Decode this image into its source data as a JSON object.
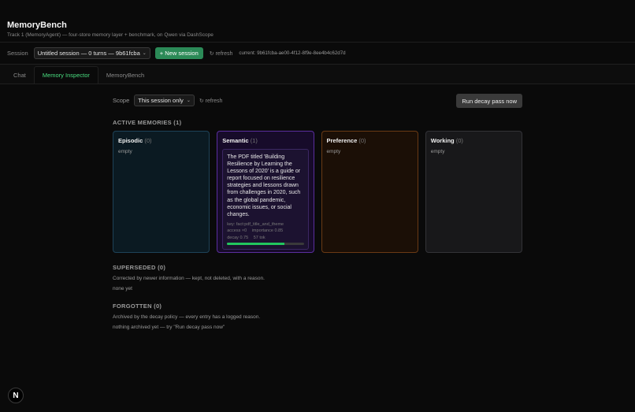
{
  "header": {
    "title": "MemoryBench",
    "subtitle": "Track 1 (MemoryAgent) — four-store memory layer + benchmark, on Qwen via DashScope"
  },
  "session_bar": {
    "label": "Session",
    "selected": "Untitled session — 0 turns — 9b61fcba",
    "new_session": "+ New session",
    "refresh": "↻ refresh",
    "current": "current: 9b61fcba-ae00-4f12-8f9e-8ee4b4c62d7d"
  },
  "tabs": [
    {
      "label": "Chat"
    },
    {
      "label": "Memory Inspector"
    },
    {
      "label": "MemoryBench"
    }
  ],
  "inspector": {
    "scope_label": "Scope",
    "scope_value": "This session only",
    "refresh": "↻ refresh",
    "decay_button": "Run decay pass now",
    "active_title": "ACTIVE MEMORIES (1)",
    "stores": [
      {
        "name": "Episodic",
        "count": "(0)",
        "empty": "empty"
      },
      {
        "name": "Semantic",
        "count": "(1)"
      },
      {
        "name": "Preference",
        "count": "(0)",
        "empty": "empty"
      },
      {
        "name": "Working",
        "count": "(0)",
        "empty": "empty"
      }
    ],
    "semantic_memory": {
      "text": "The PDF titled 'Building Resilience by Learning the Lessons of 2020' is a guide or report focused on resilience strategies and lessons drawn from challenges in 2020, such as the global pandemic, economic issues, or social changes.",
      "key": "key: fact:pdf_title_and_theme",
      "access": "access ×0",
      "importance": "importance 0.85",
      "decay": "decay 0.75",
      "tokens": "57 tok",
      "decay_value": 0.75
    },
    "superseded": {
      "title": "SUPERSEDED (0)",
      "desc": "Corrected by newer information — kept, not deleted, with a reason.",
      "none": "none yet"
    },
    "forgotten": {
      "title": "FORGOTTEN (0)",
      "desc": "Archived by the decay policy — every entry has a logged reason.",
      "none": "nothing archived yet — try \"Run decay pass now\""
    }
  },
  "logo": {
    "letter": "N"
  }
}
